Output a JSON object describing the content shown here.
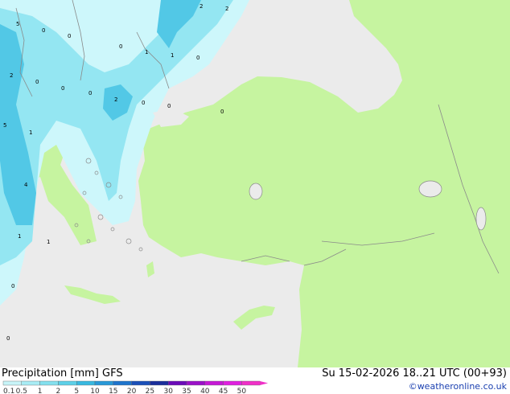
{
  "footer": {
    "title": "Precipitation [mm]  GFS",
    "datetime": "Su 15-02-2026 18..21 UTC (00+93)",
    "credit": "©weatheronline.co.uk"
  },
  "legend": {
    "labels": [
      "0.1",
      "0.5",
      "1",
      "2",
      "5",
      "10",
      "15",
      "20",
      "25",
      "30",
      "35",
      "40",
      "45",
      "50"
    ],
    "colors": [
      "#c8f4f8",
      "#a8ecf4",
      "#84e0ee",
      "#5cd0e8",
      "#38b8e0",
      "#2898d8",
      "#1e74cc",
      "#1a4fb8",
      "#1a2e9a",
      "#6a0ab8",
      "#9a10c8",
      "#c618d6",
      "#e020e0",
      "#f030c8"
    ]
  },
  "map": {
    "colors": {
      "sea": "#ebebeb",
      "land": "#c6f4a0",
      "border": "#8a8a8a",
      "precip_light": "#cdf7fb",
      "precip_mid": "#94e6f2",
      "precip_heavy": "#52c8e6"
    },
    "precip_labels": [
      "2",
      "2",
      "5",
      "0",
      "0",
      "0",
      "1",
      "0",
      "2",
      "0",
      "0",
      "2",
      "0",
      "0",
      "0",
      "1",
      "0",
      "5",
      "4",
      "1",
      "1",
      "1",
      "0",
      "0"
    ]
  }
}
